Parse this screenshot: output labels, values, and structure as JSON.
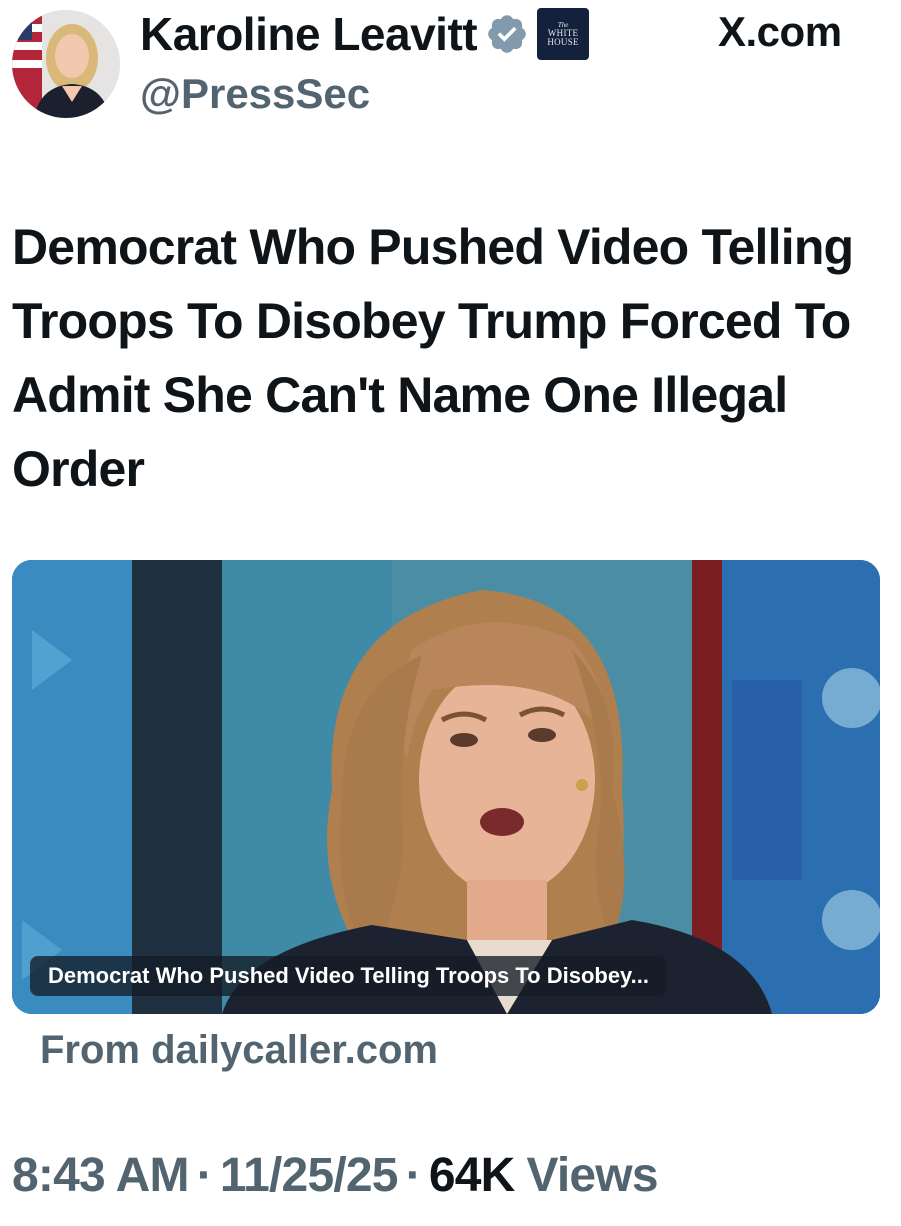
{
  "post": {
    "author": {
      "display_name": "Karoline Leavitt",
      "handle": "@PressSec",
      "verified_icon": "verified-badge-icon",
      "affiliation_badge": {
        "the": "The",
        "line1": "WHITE",
        "line2": "HOUSE"
      }
    },
    "source_site": "X.com",
    "text": "Democrat Who Pushed Video Telling Troops To Disobey Trump Forced To Admit She Can't Name One Illegal Order",
    "link_card": {
      "caption": "Democrat Who Pushed Video Telling Troops To Disobey...",
      "from_label": "From dailycaller.com"
    },
    "meta": {
      "time": "8:43 AM",
      "separator": "·",
      "date": "11/25/25",
      "views_count": "64K",
      "views_label": "Views"
    }
  },
  "colors": {
    "text_primary": "#0f1419",
    "text_secondary": "#536471",
    "verified_badge": "#829aab",
    "badge_background": "#14213d"
  }
}
